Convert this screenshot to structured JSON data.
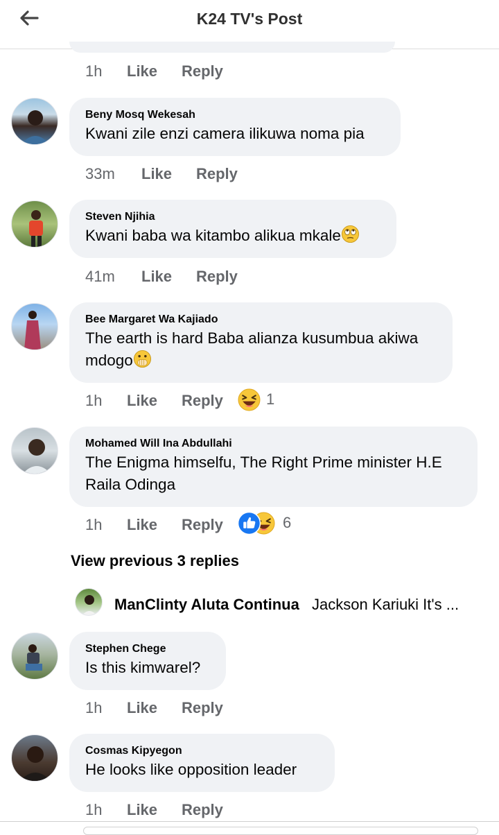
{
  "header": {
    "title": "K24 TV's Post",
    "back_icon": "back-arrow-icon"
  },
  "first_actions": {
    "time": "1h",
    "like": "Like",
    "reply": "Reply"
  },
  "comments": [
    {
      "author": "Beny Mosq Wekesah",
      "text": "Kwani zile enzi camera ilikuwa noma pia",
      "time": "33m",
      "like": "Like",
      "reply": "Reply"
    },
    {
      "author": "Steven Njihia",
      "text": "Kwani baba wa kitambo alikua mkale",
      "emoji": "face-with-rolling-eyes",
      "time": "41m",
      "like": "Like",
      "reply": "Reply"
    },
    {
      "author": "Bee Margaret Wa Kajiado",
      "text_line1": "The earth is hard Baba alianza kusumbua akiwa",
      "text_line2": "mdogo",
      "emoji": "face-with-hand-over-mouth",
      "time": "1h",
      "like": "Like",
      "reply": "Reply",
      "reaction": {
        "icons": [
          "laughing-face"
        ],
        "count": "1"
      }
    },
    {
      "author": "Mohamed Will Ina Abdullahi",
      "text_line1": "The Enigma himselfu, The Right Prime minister H.E",
      "text_line2": "Raila Odinga",
      "time": "1h",
      "like": "Like",
      "reply": "Reply",
      "reaction": {
        "icons": [
          "like-thumb",
          "laughing-face"
        ],
        "count": "6"
      }
    },
    {
      "author": "Stephen Chege",
      "text": "Is this kimwarel?",
      "time": "1h",
      "like": "Like",
      "reply": "Reply"
    },
    {
      "author": "Cosmas Kipyegon",
      "text": "He looks like opposition leader",
      "time": "1h",
      "like": "Like",
      "reply": "Reply"
    }
  ],
  "view_previous": "View previous 3 replies",
  "reply_preview": {
    "author": "ManClinty Aluta Continua",
    "text": "Jackson Kariuki It's ..."
  },
  "colors": {
    "bubble": "#f0f2f5",
    "meta": "#65676b",
    "like_blue": "#1877f2",
    "emoji_yellow": "#f7c73a"
  }
}
